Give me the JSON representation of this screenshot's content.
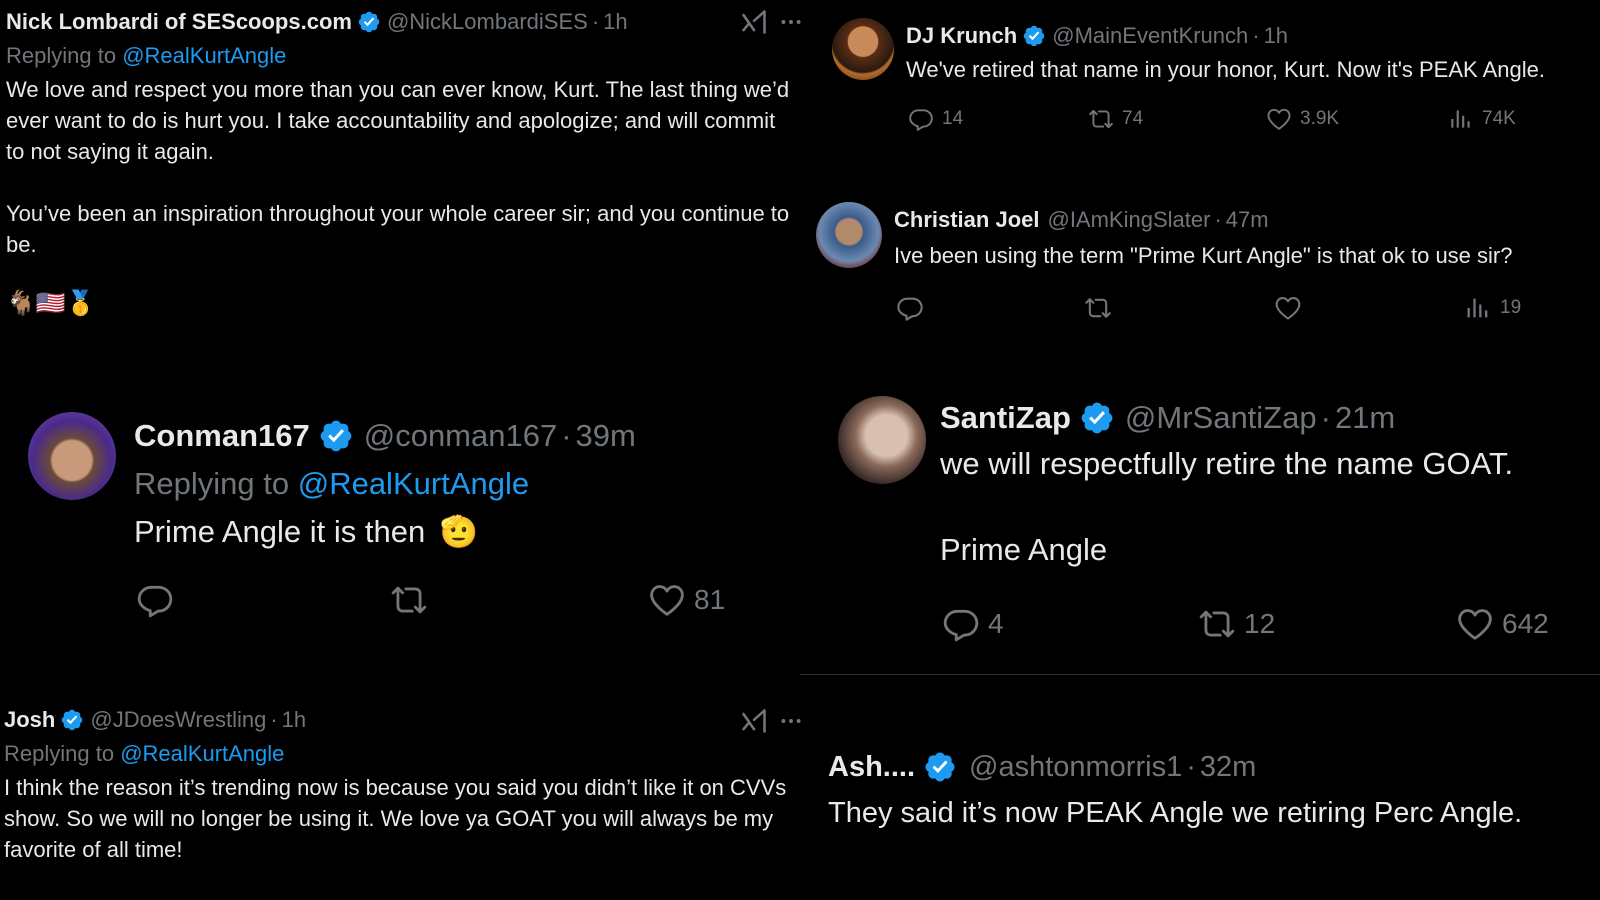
{
  "colors": {
    "background": "#000000",
    "text": "#e7e9ea",
    "muted": "#71767b",
    "link": "#1d9bf0",
    "verified": "#1d9bf0"
  },
  "tweet_nick": {
    "name": "Nick Lombardi of SEScoops.com",
    "handle": "@NickLombardiSES",
    "time": "1h",
    "replying_prefix": "Replying to",
    "replying_to": "@RealKurtAngle",
    "text": "We love and respect you more than you can ever know, Kurt. The last thing we’d ever want to do is hurt you. I take accountability and apologize; and will commit to not saying it again.\n\nYou’ve been an inspiration throughout your whole career sir; and you continue to be.",
    "emoji": "🐐🇺🇸🥇",
    "icons": [
      "grok-icon",
      "more-icon"
    ]
  },
  "tweet_djkrunch": {
    "name": "DJ Krunch",
    "handle": "@MainEventKrunch",
    "time": "1h",
    "text": "We've retired that name in your honor, Kurt. Now it's PEAK Angle.",
    "replies": "14",
    "reposts": "74",
    "likes": "3.9K",
    "views": "74K"
  },
  "tweet_christian": {
    "name": "Christian Joel",
    "handle": "@IAmKingSlater",
    "time": "47m",
    "text": "Ive been using the term \"Prime Kurt Angle\" is that ok to use sir?",
    "views": "19"
  },
  "tweet_conman": {
    "name": "Conman167",
    "handle": "@conman167",
    "time": "39m",
    "replying_prefix": "Replying to",
    "replying_to": "@RealKurtAngle",
    "text": "Prime Angle it is then",
    "emoji": "🫡",
    "likes": "81"
  },
  "tweet_santizap": {
    "name": "SantiZap",
    "handle": "@MrSantiZap",
    "time": "21m",
    "text": "we will respectfully retire the name GOAT.\n\nPrime Angle",
    "replies": "4",
    "reposts": "12",
    "likes": "642"
  },
  "tweet_josh": {
    "name": "Josh",
    "handle": "@JDoesWrestling",
    "time": "1h",
    "replying_prefix": "Replying to",
    "replying_to": "@RealKurtAngle",
    "text": "I think the reason it’s trending now is because you said you didn’t like it on CVVs show. So we will no longer be using it. We love ya GOAT you will always be my favorite of all time!"
  },
  "tweet_ash": {
    "name": "Ash....",
    "handle": "@ashtonmorris1",
    "time": "32m",
    "text": "They said it’s now PEAK Angle we retiring Perc Angle."
  }
}
